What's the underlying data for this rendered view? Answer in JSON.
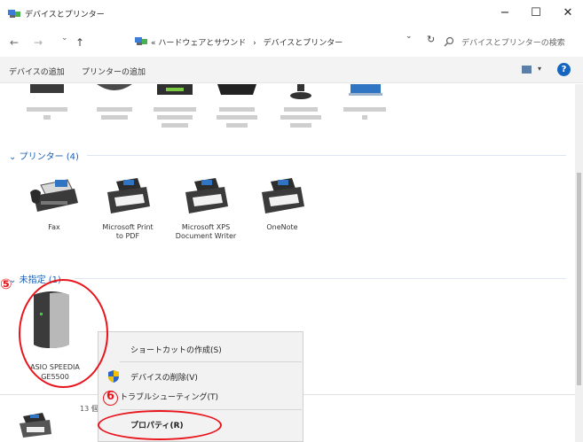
{
  "window": {
    "title": "デバイスとプリンター",
    "minimize_glyph": "−",
    "maximize_glyph": "☐",
    "close_glyph": "✕"
  },
  "address": {
    "prefix": "«",
    "path": [
      "ハードウェアとサウンド",
      "デバイスとプリンター"
    ],
    "separator": "›",
    "search_placeholder": "デバイスとプリンターの検索"
  },
  "nav": {
    "back": "←",
    "forward": "→",
    "down": "⌄",
    "up": "↑",
    "dropdown": "⌄",
    "refresh": "↻"
  },
  "command_bar": {
    "add_device": "デバイスの追加",
    "add_printer": "プリンターの追加",
    "view_dropdown": "▾",
    "help": "?"
  },
  "groups": {
    "printers": {
      "label": "プリンター (4)",
      "chevron": "⌄"
    },
    "unspecified": {
      "label": "未指定 (1)",
      "chevron": "⌄"
    }
  },
  "printers": [
    {
      "name_line1": "Fax",
      "name_line2": "",
      "icon": "fax-icon"
    },
    {
      "name_line1": "Microsoft Print",
      "name_line2": "to PDF",
      "icon": "printer-icon"
    },
    {
      "name_line1": "Microsoft XPS",
      "name_line2": "Document Writer",
      "icon": "printer-icon"
    },
    {
      "name_line1": "OneNote",
      "name_line2": "",
      "icon": "printer-icon"
    }
  ],
  "unspecified_device": {
    "name_line1": "ASIO SPEEDIA",
    "name_line2": "GE5500",
    "icon": "storage-device-icon"
  },
  "context_menu": {
    "create_shortcut": "ショートカットの作成(S)",
    "remove_device": "デバイスの削除(V)",
    "troubleshoot": "トラブルシューティング(T)",
    "properties": "プロパティ(R)"
  },
  "status": {
    "item_count": "13 個"
  },
  "annotations": {
    "step5": "⑤",
    "step6": "6"
  },
  "colors": {
    "accent_blue": "#1a5fb4",
    "annotation_red": "#e8151d",
    "help_blue": "#1565c0"
  }
}
